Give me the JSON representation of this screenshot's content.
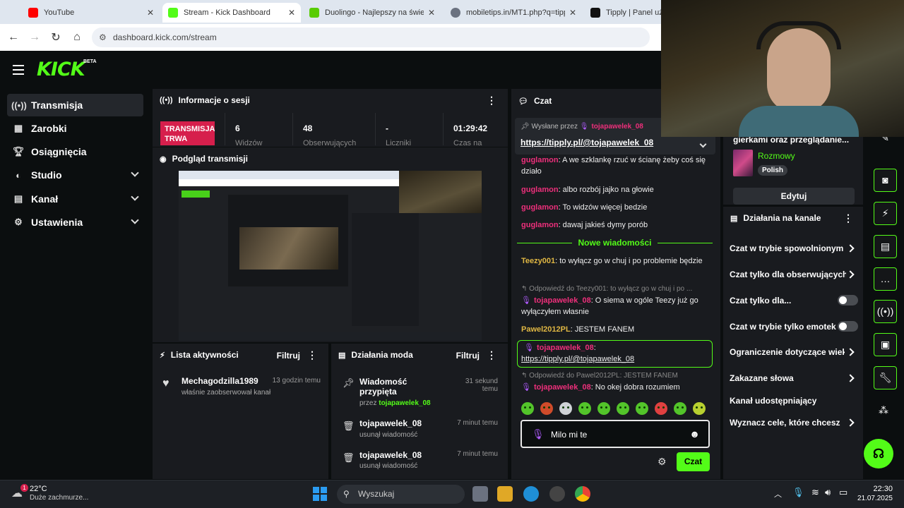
{
  "browser": {
    "tabs": [
      {
        "label": "YouTube",
        "color": "#ff0000"
      },
      {
        "label": "Stream - Kick Dashboard",
        "color": "#53fc18"
      },
      {
        "label": "Duolingo - Najlepszy na świecie",
        "color": "#58cc02"
      },
      {
        "label": "mobiletips.in/MT1.php?q=tipp",
        "color": "#6b7280"
      },
      {
        "label": "Tipply | Panel użytk",
        "color": "#111111"
      }
    ],
    "url": "dashboard.kick.com/stream"
  },
  "app": {
    "logo": "KICK",
    "beta": "BETA"
  },
  "sidebar": {
    "items": [
      {
        "label": "Transmisja",
        "icon": "broadcast-icon"
      },
      {
        "label": "Zarobki",
        "icon": "earnings-icon"
      },
      {
        "label": "Osiągnięcia",
        "icon": "trophy-icon"
      },
      {
        "label": "Studio",
        "icon": "studio-icon"
      },
      {
        "label": "Kanał",
        "icon": "channel-icon"
      },
      {
        "label": "Ustawienia",
        "icon": "gear-icon"
      }
    ]
  },
  "session": {
    "title": "Informacje o sesji",
    "badge": "TRANSMISJA TRWA",
    "stats": [
      {
        "value": "6",
        "label": "Widzów"
      },
      {
        "value": "48",
        "label": "Obserwujących"
      },
      {
        "value": "-",
        "label": "Liczniki"
      },
      {
        "value": "01:29:42",
        "label": "Czas na"
      }
    ]
  },
  "preview": {
    "title": "Podgląd transmisji"
  },
  "activity": {
    "title": "Lista aktywności",
    "filter": "Filtruj",
    "items": [
      {
        "name": "Mechagodzilla1989",
        "time": "13 godzin temu",
        "sub": "właśnie zaobserwował kanał"
      }
    ]
  },
  "modactions": {
    "title": "Działania moda",
    "filter": "Filtruj",
    "items": [
      {
        "title": "Wiadomość przypięta",
        "by_label": "przez",
        "by": "tojapawelek_08",
        "time": "31 sekund temu"
      },
      {
        "title": "tojapawelek_08",
        "sub": "usunął wiadomość",
        "time": "7 minut temu"
      },
      {
        "title": "tojapawelek_08",
        "sub": "usunął wiadomość",
        "time": "7 minut temu"
      }
    ]
  },
  "chat": {
    "title": "Czat",
    "pinned": {
      "by_label": "Wysłane przez",
      "by": "tojapawelek_08",
      "link": "https://tipply.pl/@tojapawelek_08"
    },
    "partial": {
      "user": "guglamon",
      "text": ": A we szklankę rzuć w ścianę żeby coś się działo"
    },
    "messages": [
      {
        "user": "guglamon",
        "text": ": albo rozbój jajko na głowie"
      },
      {
        "user": "guglamon",
        "text": ": To widzów więcej bedzie"
      },
      {
        "user": "guglamon",
        "text": ": dawaj jakieś dymy porób"
      }
    ],
    "new_label": "Nowe wiadomości",
    "new": [
      {
        "user": "Teezy001",
        "text": ": to wyłącz go w chuj i po problemie będzie"
      }
    ],
    "reply1": {
      "ref": "Odpowiedź do Teezy001: to wyłącz go w chuj i po ...",
      "user": "tojapawelek_08",
      "text": ": O siema w ogóle Teezy już go wyłączyłem własnie"
    },
    "pawel": {
      "user": "Pawel2012PL",
      "text": ": JESTEM FANEM"
    },
    "highlight": {
      "user": "tojapawelek_08",
      "text": ":",
      "link": "https://tipply.pl/@tojapawelek_08"
    },
    "reply2": {
      "ref": "Odpowiedź do Pawel2012PL: JESTEM FANEM",
      "user": "tojapawelek_08",
      "text": ": No okej dobra rozumiem"
    },
    "input_value": "Milo mi te",
    "send": "Czat"
  },
  "category": {
    "title": "gierkami oraz przeglądanie...",
    "name": "Rozmowy",
    "lang": "Polish",
    "edit": "Edytuj"
  },
  "channel_actions": {
    "title": "Działania na kanale",
    "items": [
      {
        "label": "Czat w trybie spowolnionym",
        "kind": "chevron"
      },
      {
        "label": "Czat tylko dla obserwujących",
        "kind": "chevron"
      },
      {
        "label": "Czat tylko dla...",
        "kind": "toggle"
      },
      {
        "label": "Czat w trybie tylko emotek",
        "kind": "toggle"
      },
      {
        "label": "Ograniczenie dotyczące wieku",
        "kind": "chevron"
      },
      {
        "label": "Zakazane słowa",
        "kind": "chevron"
      },
      {
        "label": "Kanał udostępniający",
        "kind": "none"
      },
      {
        "label": "Wyznacz cele, które chcesz",
        "kind": "chevron"
      }
    ]
  },
  "taskbar": {
    "weather_temp": "22°C",
    "weather_desc": "Duże zachmurze...",
    "weather_badge": "1",
    "search": "Wyszukaj",
    "time": "22:30",
    "date": "21.07.2025"
  },
  "colors": {
    "accent": "#53fc18",
    "live": "#d61f4c",
    "username": "#ee2f7b"
  }
}
